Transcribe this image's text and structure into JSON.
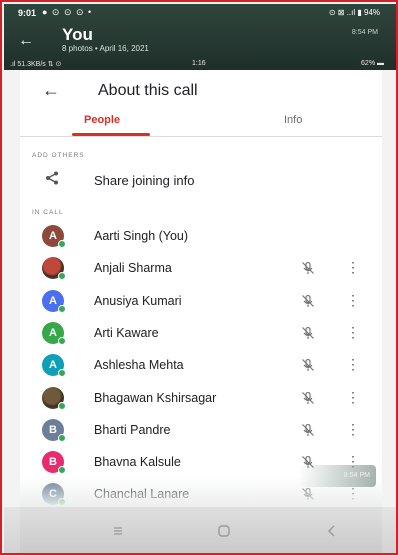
{
  "status_bar": {
    "time": "9:01",
    "icons": "● ⊙ ⊙ ⊙ •",
    "right": "⊙ ⊠ ..ıl ▮ 94%"
  },
  "gallery": {
    "back_icon": "arrow-left-icon",
    "title": "You",
    "subtitle": "8 photos  •  April 16, 2021",
    "timestamp": "8:54 PM"
  },
  "inner_status": {
    "left": ".ıl 51.3KB/s ⇅ ⊙",
    "middle": "1:16",
    "right": "62% ▬"
  },
  "dialog": {
    "back_icon": "arrow-left-icon",
    "title": "About this call",
    "tabs": [
      {
        "label": "People",
        "active": true
      },
      {
        "label": "Info",
        "active": false
      }
    ],
    "sections": {
      "add_others": "ADD OTHERS",
      "in_call": "IN CALL"
    },
    "share": {
      "icon": "share-icon",
      "label": "Share joining info"
    },
    "participants": [
      {
        "initial": "A",
        "name": "Aarti Singh (You)",
        "color": "#8d4a3c",
        "photo": false,
        "muted": false
      },
      {
        "initial": "",
        "name": "Anjali Sharma",
        "color": "#c0483b",
        "photo": true,
        "muted": true
      },
      {
        "initial": "A",
        "name": "Anusiya Kumari",
        "color": "#4c6ef0",
        "photo": false,
        "muted": true
      },
      {
        "initial": "A",
        "name": "Arti Kaware",
        "color": "#37a84a",
        "photo": false,
        "muted": true
      },
      {
        "initial": "A",
        "name": "Ashlesha Mehta",
        "color": "#0f9fb8",
        "photo": false,
        "muted": true
      },
      {
        "initial": "",
        "name": "Bhagawan Kshirsagar",
        "color": "#6e5a3a",
        "photo": true,
        "muted": true
      },
      {
        "initial": "B",
        "name": "Bharti Pandre",
        "color": "#6b7f99",
        "photo": false,
        "muted": true
      },
      {
        "initial": "B",
        "name": "Bhavna Kalsule",
        "color": "#e82a6e",
        "photo": false,
        "muted": true
      },
      {
        "initial": "C",
        "name": "Chanchal Lanare",
        "color": "#6b7f99",
        "photo": false,
        "muted": true
      }
    ],
    "toast_time": "8:54 PM"
  },
  "navbar": {
    "recents_icon": "recents-icon",
    "home_icon": "home-icon",
    "back_icon": "back-icon"
  },
  "colors": {
    "accent": "#d93025",
    "frame_border": "#d81f26",
    "online_dot": "#34a853"
  }
}
